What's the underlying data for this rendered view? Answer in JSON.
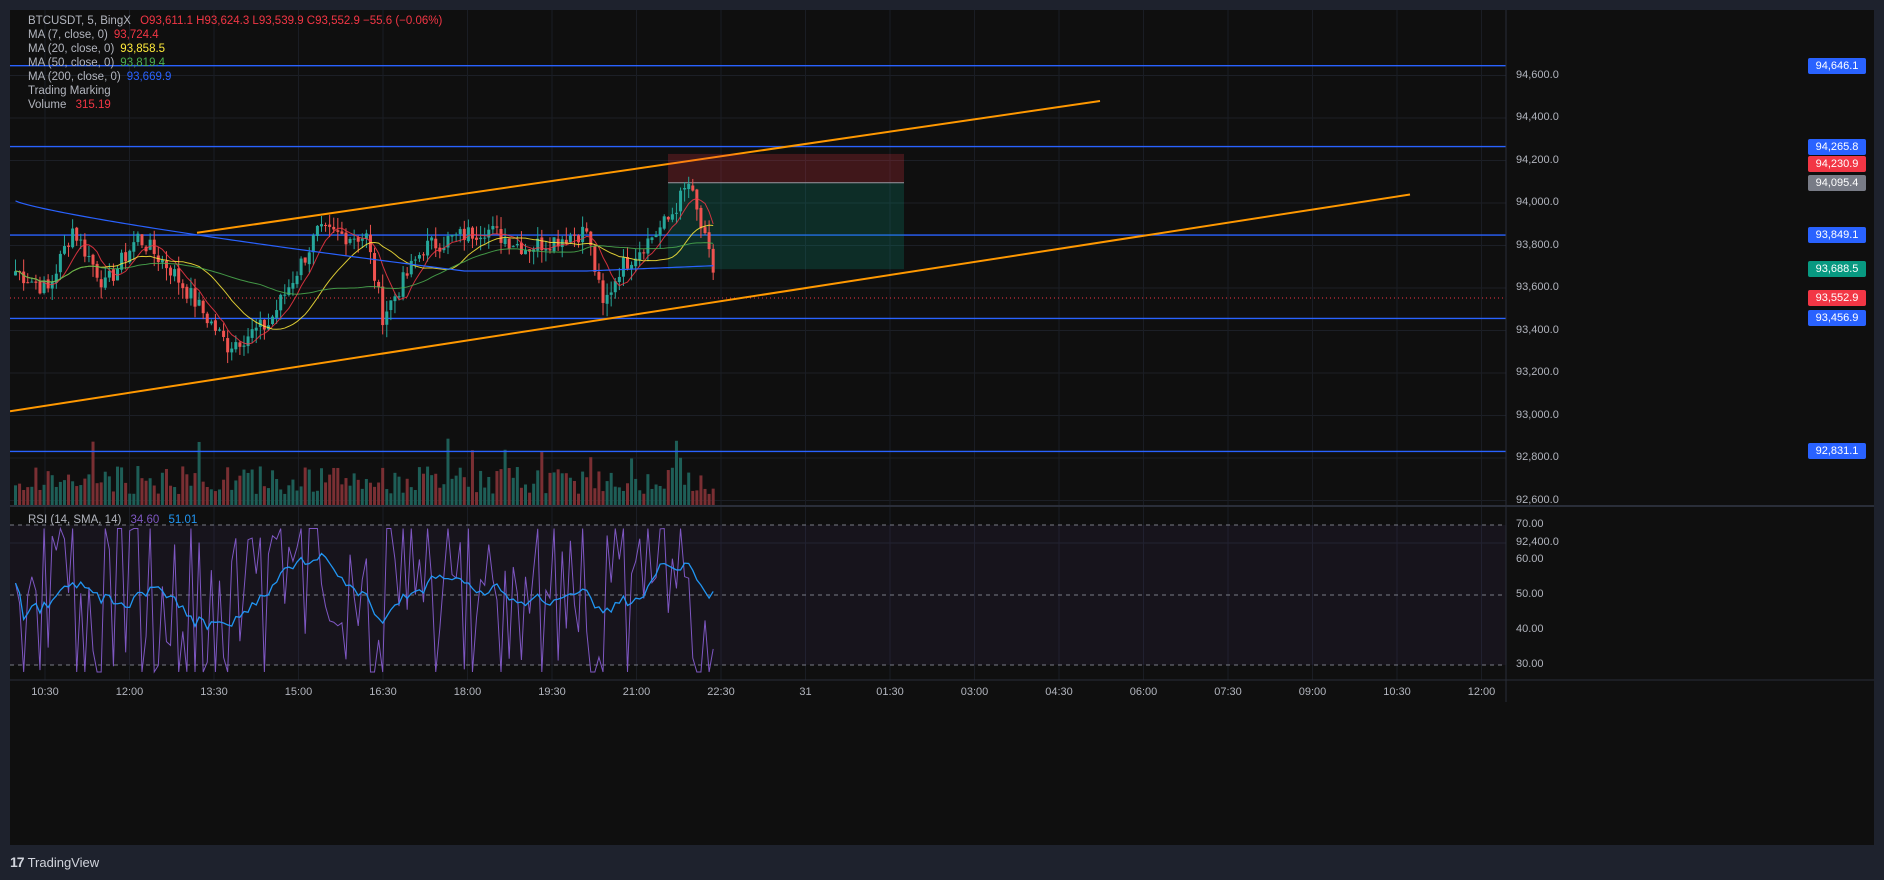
{
  "legend": {
    "symbol_line": {
      "symbol": "BTCUSDT, 5, BingX",
      "ohlc": "O93,611.1  H93,624.3  L93,539.9  C93,552.9  −55.6 (−0.06%)"
    },
    "ma": [
      {
        "label": "MA (7, close, 0)",
        "value": "93,724.4",
        "color": "#f23645"
      },
      {
        "label": "MA (20, close, 0)",
        "value": "93,858.5",
        "color": "#ffeb3b"
      },
      {
        "label": "MA (50, close, 0)",
        "value": "93,819.4",
        "color": "#4caf50"
      },
      {
        "label": "MA (200, close, 0)",
        "value": "93,669.9",
        "color": "#2962ff"
      }
    ],
    "trading_marking": "Trading Marking",
    "volume": {
      "label": "Volume",
      "value": "315.19",
      "color": "#f23645"
    },
    "rsi": {
      "label": "RSI (14, SMA, 14)",
      "value": "34.60",
      "sma_value": "51.01",
      "color": "#7e57c2",
      "sma_color": "#2196f3"
    }
  },
  "price_axis": {
    "ticks": [
      "94,600.0",
      "94,400.0",
      "94,200.0",
      "94,000.0",
      "93,800.0",
      "93,600.0",
      "93,400.0",
      "93,200.0",
      "93,000.0",
      "92,800.0",
      "92,600.0",
      "92,400.0"
    ],
    "badges": [
      {
        "text": "94,646.1",
        "color": "#2962ff"
      },
      {
        "text": "94,265.8",
        "color": "#2962ff"
      },
      {
        "text": "94,230.9",
        "color": "#f23645"
      },
      {
        "text": "94,095.4",
        "color": "#787b86"
      },
      {
        "text": "93,849.1",
        "color": "#2962ff"
      },
      {
        "text": "93,688.5",
        "color": "#089981"
      },
      {
        "text": "93,552.9",
        "color": "#f23645"
      },
      {
        "text": "93,456.9",
        "color": "#2962ff"
      },
      {
        "text": "92,831.1",
        "color": "#2962ff"
      }
    ]
  },
  "rsi_axis": {
    "ticks": [
      "70.00",
      "60.00",
      "50.00",
      "40.00",
      "30.00"
    ]
  },
  "time_axis": {
    "ticks": [
      "10:30",
      "12:00",
      "13:30",
      "15:00",
      "16:30",
      "18:00",
      "19:30",
      "21:00",
      "22:30",
      "31",
      "01:30",
      "03:00",
      "04:30",
      "06:00",
      "07:30",
      "09:00",
      "10:30",
      "12:00"
    ]
  },
  "colors": {
    "up": "#26a69a",
    "down": "#ef5350",
    "hline": "#2962ff",
    "trendline": "#ff9800"
  },
  "footer": {
    "brand": "TradingView"
  }
}
